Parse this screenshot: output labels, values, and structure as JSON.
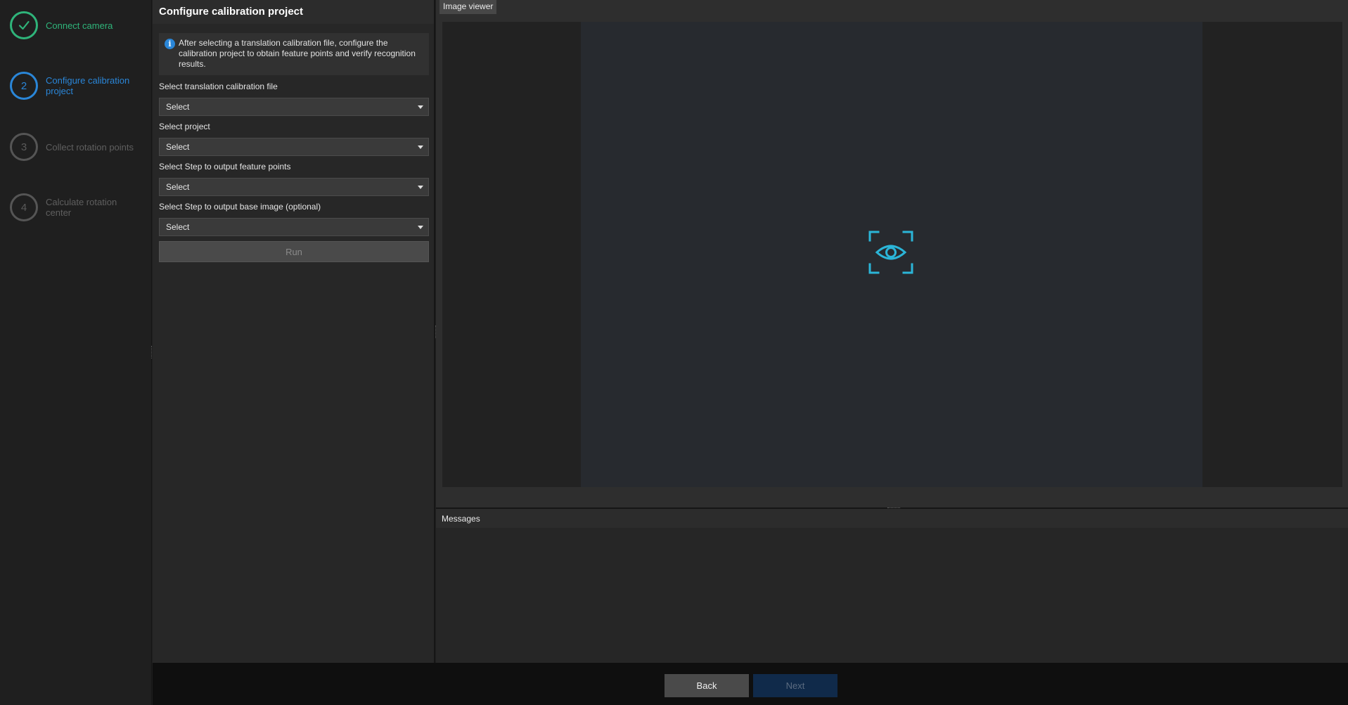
{
  "steps": [
    {
      "number": "",
      "label": "Connect camera",
      "state": "done",
      "icon": "check-icon"
    },
    {
      "number": "2",
      "label": "Configure calibration project",
      "state": "active"
    },
    {
      "number": "3",
      "label": "Collect rotation points",
      "state": "pending"
    },
    {
      "number": "4",
      "label": "Calculate rotation center",
      "state": "pending"
    }
  ],
  "config": {
    "title": "Configure calibration project",
    "info": "After selecting a translation calibration file, configure the calibration project to obtain feature points and verify recognition results.",
    "fields": [
      {
        "label": "Select translation calibration file",
        "value": "Select"
      },
      {
        "label": "Select project",
        "value": "Select"
      },
      {
        "label": "Select Step to output feature points",
        "value": "Select"
      },
      {
        "label": "Select Step to output base image (optional)",
        "value": "Select"
      }
    ],
    "run_label": "Run"
  },
  "viewer": {
    "tab_label": "Image viewer",
    "placeholder_icon": "eye-focus-icon"
  },
  "messages": {
    "header": "Messages"
  },
  "footer": {
    "back_label": "Back",
    "next_label": "Next"
  },
  "colors": {
    "done": "#2fb47a",
    "active": "#2a86d8",
    "pending": "#555555",
    "accent_icon": "#2bb5d8",
    "next_disabled_bg": "#102a4a"
  }
}
